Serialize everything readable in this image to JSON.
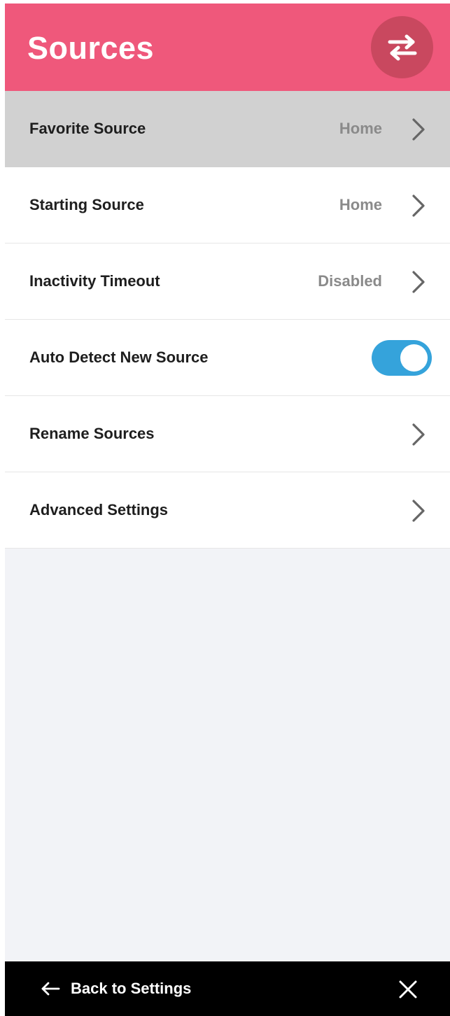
{
  "header": {
    "title": "Sources",
    "swap_icon": "swap-arrows-icon",
    "accent": "#ef587b"
  },
  "settings": {
    "rows": [
      {
        "label": "Favorite Source",
        "value": "Home",
        "icon": "chevron-right-icon",
        "selected": true
      },
      {
        "label": "Starting Source",
        "value": "Home",
        "icon": "chevron-right-icon"
      },
      {
        "label": "Inactivity Timeout",
        "value": "Disabled",
        "icon": "chevron-right-icon"
      },
      {
        "label": "Auto Detect New Source",
        "toggle_on": true,
        "toggle_color": "#35a3db"
      },
      {
        "label": "Rename Sources",
        "icon": "chevron-right-icon"
      },
      {
        "label": "Advanced Settings",
        "icon": "chevron-right-icon"
      }
    ]
  },
  "footer": {
    "back_label": "Back to Settings",
    "back_icon": "arrow-left-icon",
    "close_icon": "close-icon"
  }
}
